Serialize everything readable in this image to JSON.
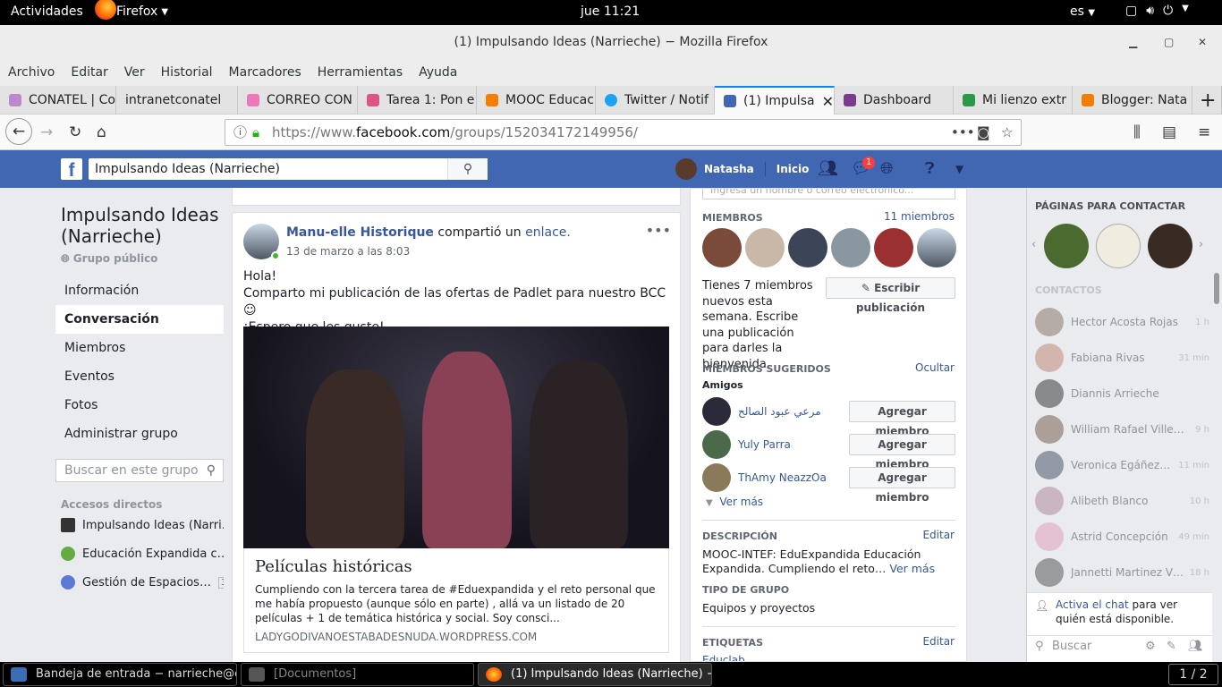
{
  "gnome": {
    "activities": "Actividades",
    "app": "Firefox",
    "clock": "jue 11:21",
    "lang": "es"
  },
  "window": {
    "title": "(1) Impulsando Ideas (Narrieche) − Mozilla Firefox"
  },
  "menu": [
    "Archivo",
    "Editar",
    "Ver",
    "Historial",
    "Marcadores",
    "Herramientas",
    "Ayuda"
  ],
  "tabs": [
    {
      "label": "CONATEL | Co",
      "color": "#b8c"
    },
    {
      "label": "intranetconatel",
      "color": "#fff"
    },
    {
      "label": "CORREO CON",
      "color": "#e7b"
    },
    {
      "label": "Tarea 1: Pon e",
      "color": "#d58"
    },
    {
      "label": "MOOC Educac",
      "color": "#f57d00"
    },
    {
      "label": "Twitter / Notif",
      "color": "#1da1f2"
    },
    {
      "label": "(1) Impulsa",
      "color": "#4267b2"
    },
    {
      "label": "Dashboard",
      "color": "#7a3b8f"
    },
    {
      "label": "Mi lienzo extr",
      "color": "#2a9a48"
    },
    {
      "label": "Blogger: Nata",
      "color": "#f57d00"
    }
  ],
  "url": {
    "prefix": "https://www.",
    "domain": "facebook.com",
    "path": "/groups/152034172149956/"
  },
  "fb": {
    "search": "Impulsando Ideas (Narrieche)",
    "user": "Natasha",
    "home": "Inicio",
    "badge": "1"
  },
  "group": {
    "title": "Impulsando Ideas (Narrieche)",
    "privacy": "Grupo público",
    "nav": [
      "Información",
      "Conversación",
      "Miembros",
      "Eventos",
      "Fotos",
      "Administrar grupo"
    ],
    "search_placeholder": "Buscar en este grupo",
    "shortcuts_label": "Accesos directos",
    "shortcuts": [
      {
        "label": "Impulsando Ideas (Narri…",
        "icon": "graduation-cap-icon"
      },
      {
        "label": "Educación Expandida c…",
        "icon": "plant-icon"
      },
      {
        "label": "Gestión de Espacios…",
        "icon": "group-icon",
        "count": "3"
      }
    ]
  },
  "post": {
    "author": "Manu-elle Historique",
    "action": "compartió un",
    "link_word": "enlace.",
    "date": "13 de marzo a las 8:03",
    "lines": [
      "Hola!",
      "Comparto mi publicación de las ofertas de Padlet para nuestro BCC ☺",
      "¡Espero que les guste!"
    ],
    "link_title": "Películas históricas",
    "link_desc": "Cumpliendo con la tercera tarea de #Eduexpandida y el reto personal que me había propuesto (aunque sólo en parte) , allá va un listado de 20 películas + 1 de temática histórica y social. Soy consci...",
    "link_domain": "LADYGODIVANOESTABADESNUDA.WORDPRESS.COM"
  },
  "members": {
    "input_placeholder": "Ingresa un nombre o correo electrónico...",
    "heading": "MIEMBROS",
    "count": "11 miembros",
    "new_text": "Tienes 7 miembros nuevos esta semana. Escribe una publicación para darles la bienvenida.",
    "write_btn": "Escribir publicación",
    "suggested": "MIEMBROS SUGERIDOS",
    "hide": "Ocultar",
    "friends": "Amigos",
    "people": [
      "مرعي عبود الصالح",
      "Yuly Parra",
      "ThAmy NeazzOa"
    ],
    "add_btn": "Agregar miembro",
    "see_more": "Ver más",
    "desc_h": "DESCRIPCIÓN",
    "edit": "Editar",
    "desc": "MOOC-INTEF: EduExpandida Educación Expandida. Cumpliendo el reto…",
    "desc_more": "Ver más",
    "type_h": "TIPO DE GRUPO",
    "type": "Equipos y proyectos",
    "tags_h": "ETIQUETAS",
    "tags_first": "Educlab"
  },
  "sidebar": {
    "pages_h": "PÁGINAS PARA CONTACTAR",
    "contacts_h": "CONTACTOS",
    "contacts": [
      {
        "name": "Hector Acosta Rojas",
        "time": "1 h"
      },
      {
        "name": "Fabiana Rivas",
        "time": "31 min"
      },
      {
        "name": "Diannis Arrieche",
        "time": ""
      },
      {
        "name": "William Rafael Ville…",
        "time": "9 h"
      },
      {
        "name": "Veronica Egáñez…",
        "time": "11 min"
      },
      {
        "name": "Alibeth Blanco",
        "time": "10 h"
      },
      {
        "name": "Astrid Concepción",
        "time": "49 min"
      },
      {
        "name": "Jannetti Martinez V…",
        "time": "18 h"
      }
    ],
    "chat_link": "Activa el chat",
    "chat_text": "para ver quién está disponible.",
    "search": "Buscar"
  },
  "taskbar": [
    {
      "label": "Bandeja de entrada − narrieche@c…"
    },
    {
      "label": "[Documentos]"
    },
    {
      "label": "(1) Impulsando Ideas (Narrieche) −…"
    }
  ],
  "workspace": "1 / 2"
}
